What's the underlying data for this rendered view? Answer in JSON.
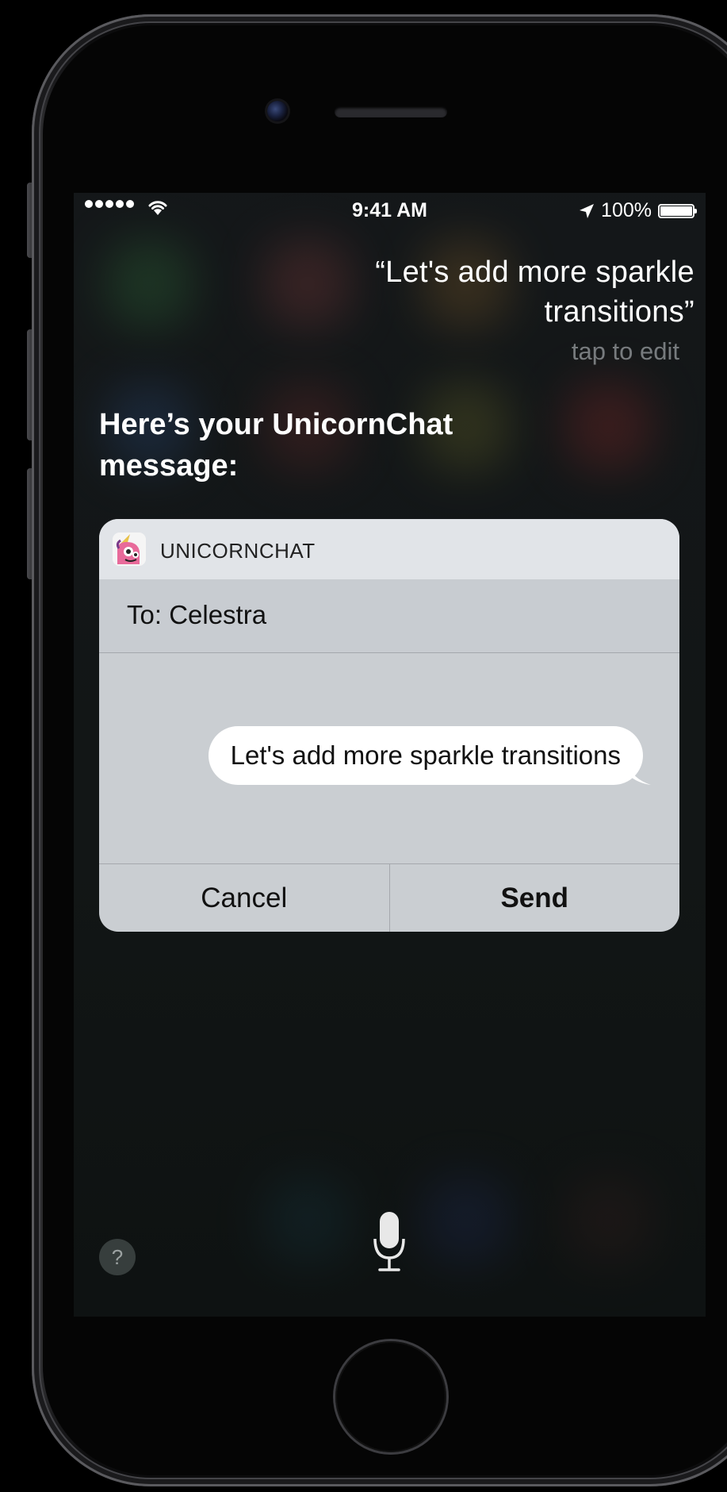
{
  "status_bar": {
    "time": "9:41 AM",
    "battery": "100%"
  },
  "siri": {
    "query": "“Let's add more sparkle transitions”",
    "tap_to_edit": "tap to edit",
    "response": "Here’s your UnicornChat message:"
  },
  "card": {
    "app_name": "UNICORNCHAT",
    "to_line": "To: Celestra",
    "message": "Let's add more sparkle transitions",
    "cancel_label": "Cancel",
    "send_label": "Send"
  },
  "help_label": "?",
  "colors": {
    "card_bg": "#d6dade",
    "bubble": "#ffffff",
    "screen_bg": "#14181a"
  },
  "icons": [
    "signal-dots",
    "wifi-icon",
    "location-arrow-icon",
    "battery-icon",
    "unicorn-app-icon",
    "help-icon",
    "microphone-icon"
  ]
}
